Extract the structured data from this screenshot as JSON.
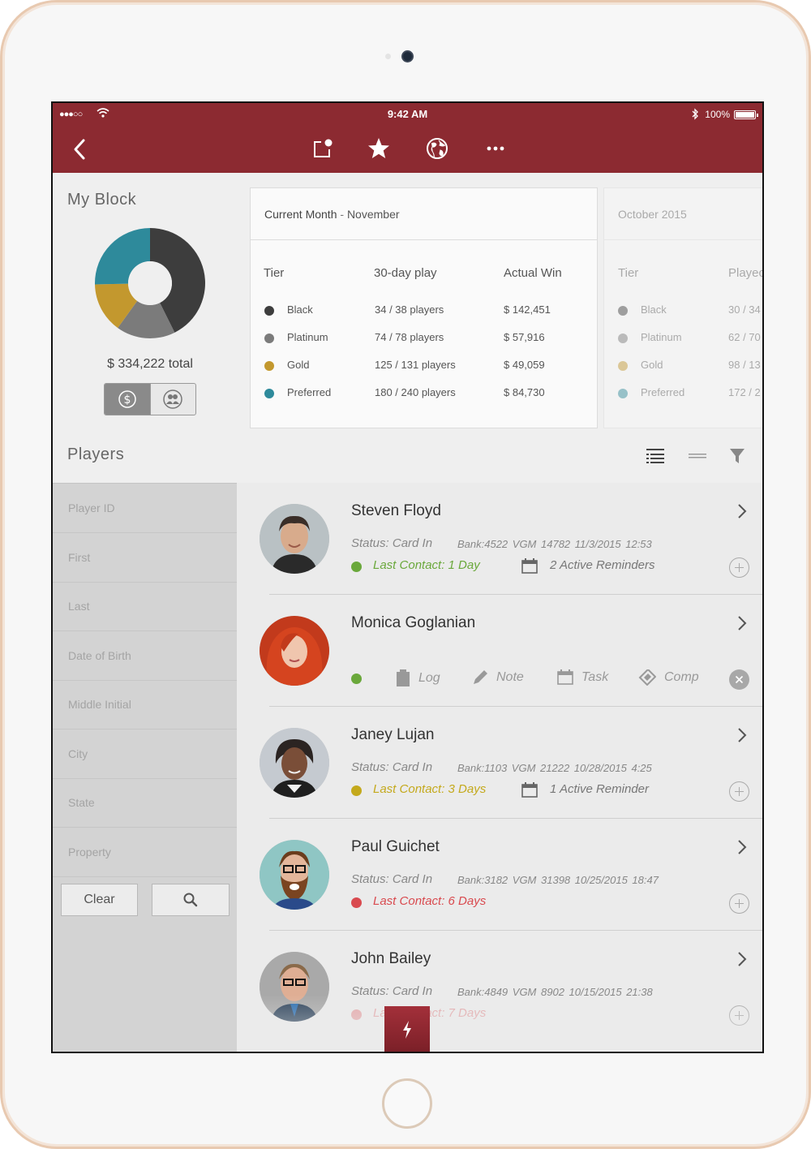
{
  "status_bar": {
    "signal": "●●●○○",
    "time": "9:42 AM",
    "battery": "100%"
  },
  "colors": {
    "brand": "#8c2a31",
    "tier_black": "#3d3d3d",
    "tier_platinum": "#7b7b7b",
    "tier_gold": "#c3982e",
    "tier_preferred": "#2e8a9b",
    "contact_good": "#6aa83b",
    "contact_warn": "#c4a91c",
    "contact_bad": "#d94a4f"
  },
  "nav": {
    "icons": [
      "back-chevron-icon",
      "notification-icon",
      "star-icon",
      "globe-icon",
      "more-icon"
    ]
  },
  "my_block": {
    "title": "My Block",
    "total": "$ 334,222 total",
    "chart_data": {
      "type": "pie",
      "categories": [
        "Black",
        "Platinum",
        "Gold",
        "Preferred"
      ],
      "values": [
        142451,
        57916,
        49059,
        84730
      ]
    }
  },
  "current": {
    "month_label": "Current Month",
    "separator": " - ",
    "month": "November",
    "headers": [
      "Tier",
      "30-day play",
      "Actual Win"
    ],
    "rows": [
      {
        "tier": "Black",
        "play": "34 / 38 players",
        "win": "$ 142,451"
      },
      {
        "tier": "Platinum",
        "play": "74 / 78 players",
        "win": "$ 57,916"
      },
      {
        "tier": "Gold",
        "play": "125 / 131 players",
        "win": "$ 49,059"
      },
      {
        "tier": "Preferred",
        "play": "180 / 240 players",
        "win": "$ 84,730"
      }
    ]
  },
  "previous": {
    "title": "October 2015",
    "headers": [
      "Tier",
      "Playec"
    ],
    "rows": [
      {
        "tier": "Black",
        "play": "30 / 34"
      },
      {
        "tier": "Platinum",
        "play": "62 / 70"
      },
      {
        "tier": "Gold",
        "play": "98 / 13"
      },
      {
        "tier": "Preferred",
        "play": "172 / 2"
      }
    ]
  },
  "players": {
    "title": "Players",
    "filters": [
      "Player ID",
      "First",
      "Last",
      "Date of Birth",
      "Middle Initial",
      "City",
      "State",
      "Property"
    ],
    "clear_label": "Clear",
    "list": [
      {
        "name": "Steven Floyd",
        "status": "Status: Card In",
        "meta": "Bank:4522  VGM 14782  11/3/2015  12:53",
        "contact": "Last Contact: 1 Day",
        "reminders": "2 Active Reminders"
      },
      {
        "name": "Monica Goglanian",
        "actions": [
          "Log",
          "Note",
          "Task",
          "Comp"
        ]
      },
      {
        "name": "Janey Lujan",
        "status": "Status: Card In",
        "meta": "Bank:1103  VGM 21222  10/28/2015  4:25",
        "contact": "Last Contact: 3 Days",
        "reminders": "1 Active Reminder"
      },
      {
        "name": "Paul Guichet",
        "status": "Status: Card In",
        "meta": "Bank:3182  VGM 31398  10/25/2015  18:47",
        "contact": "Last Contact: 6 Days"
      },
      {
        "name": "John Bailey",
        "status": "Status: Card In",
        "meta": "Bank:4849  VGM 8902  10/15/2015  21:38",
        "contact": "Last Contact: 7 Days"
      }
    ]
  }
}
